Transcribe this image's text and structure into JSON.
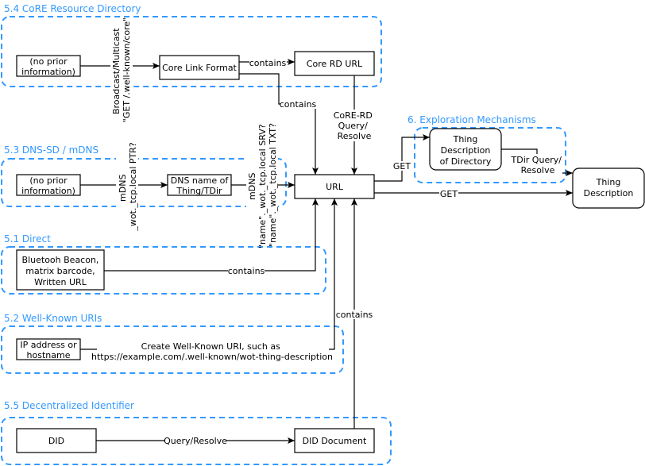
{
  "colors": {
    "group": "#3399ff",
    "stroke": "#000000"
  },
  "groups": {
    "core": "5.4 CoRE Resource Directory",
    "dns": "5.3 DNS-SD / mDNS",
    "direct": "5.1 Direct",
    "wellknown": "5.2 Well-Known URIs",
    "did": "5.5 Decentralized Identifier",
    "exploration": "6. Exploration Mechanisms"
  },
  "nodes": {
    "noprior1": [
      "(no prior",
      "information)"
    ],
    "corelink": "Core Link Format",
    "corerd": "Core RD URL",
    "noprior2": [
      "(no prior",
      "information)"
    ],
    "dnsname": [
      "DNS name of",
      "Thing/TDir"
    ],
    "url": "URL",
    "bluetooth": [
      "Bluetooh Beacon,",
      "matrix barcode,",
      "Written URL"
    ],
    "ip": [
      "IP address or",
      "hostname"
    ],
    "did": "DID",
    "diddoc": "DID Document",
    "tdd": [
      "Thing",
      "Description",
      "of Directory"
    ],
    "td": [
      "Thing",
      "Description"
    ]
  },
  "edges": {
    "broadcast": [
      "Broadcast/Multicast",
      "\"GET /.well-known/core\""
    ],
    "contains1": "contains",
    "contains2": "contains",
    "corerd_query": [
      "CoRE-RD",
      "Query/",
      "Resolve"
    ],
    "mdns_ptr": [
      "mDNS",
      "_wot._tcp.local PTR?"
    ],
    "mdns_srv": [
      "mDNS",
      "\"name\"._wot._tcp.local SRV?",
      "\"name\"._wot._tcp.local TXT?"
    ],
    "contains_direct": "contains",
    "wellknown": [
      "Create Well-Known URI, such as",
      "https://example.com/.well-known/wot-thing-description"
    ],
    "contains_did": "contains",
    "query_resolve": "Query/Resolve",
    "get1": "GET",
    "get2": "GET",
    "tdir_query": [
      "TDir Query/",
      "Resolve"
    ]
  }
}
